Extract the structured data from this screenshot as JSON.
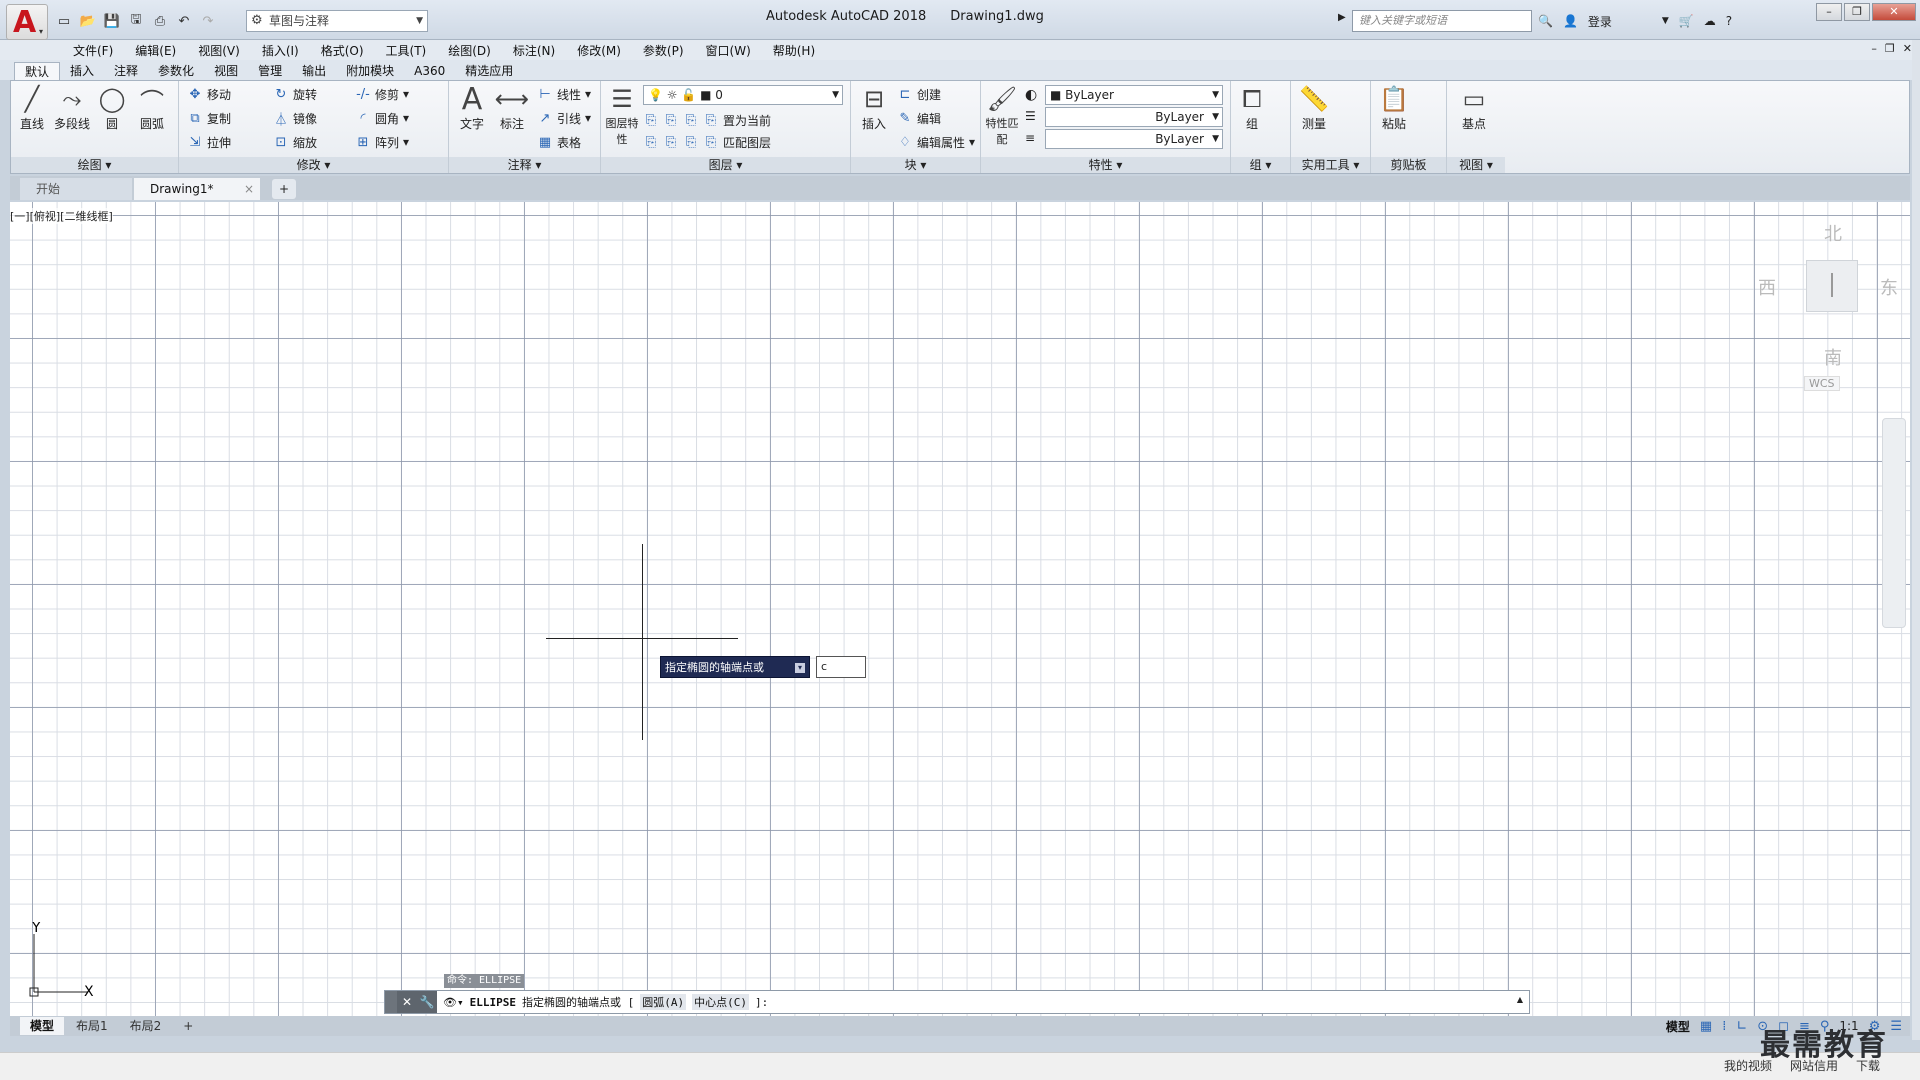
{
  "app": {
    "logo_letter": "A",
    "title": "Autodesk AutoCAD 2018",
    "document": "Drawing1.dwg",
    "workspace": "草图与注释",
    "search_placeholder": "键入关键字或短语",
    "login_label": "登录"
  },
  "menubar": [
    "文件(F)",
    "编辑(E)",
    "视图(V)",
    "插入(I)",
    "格式(O)",
    "工具(T)",
    "绘图(D)",
    "标注(N)",
    "修改(M)",
    "参数(P)",
    "窗口(W)",
    "帮助(H)"
  ],
  "ribbon_tabs": [
    "默认",
    "插入",
    "注释",
    "参数化",
    "视图",
    "管理",
    "输出",
    "附加模块",
    "A360",
    "精选应用"
  ],
  "panels": {
    "draw": {
      "title": "绘图",
      "line": "直线",
      "polyline": "多段线",
      "circle": "圆",
      "arc": "圆弧"
    },
    "modify": {
      "title": "修改",
      "move": "移动",
      "rotate": "旋转",
      "trim": "修剪",
      "copy": "复制",
      "mirror": "镜像",
      "fillet": "圆角",
      "stretch": "拉伸",
      "scale": "缩放",
      "array": "阵列"
    },
    "annotation": {
      "title": "注释",
      "text": "文字",
      "dimension": "标注",
      "linear": "线性",
      "leader": "引线",
      "table": "表格"
    },
    "layers": {
      "title": "图层",
      "props": "图层特性",
      "current_layer": "0",
      "set_current": "置为当前",
      "match": "匹配图层"
    },
    "block": {
      "title": "块",
      "insert": "插入",
      "create": "创建",
      "edit": "编辑",
      "edit_attr": "编辑属性"
    },
    "properties": {
      "title": "特性",
      "match": "特性匹配",
      "color": "ByLayer",
      "linetype": "ByLayer",
      "lineweight": "ByLayer"
    },
    "groups": {
      "title": "组",
      "group": "组"
    },
    "utilities": {
      "title": "实用工具",
      "measure": "测量"
    },
    "clipboard": {
      "title": "剪贴板",
      "paste": "粘贴"
    },
    "view": {
      "title": "视图",
      "base": "基点"
    }
  },
  "doc_tabs": {
    "start": "开始",
    "active": "Drawing1*"
  },
  "viewport": {
    "label": "[一][俯视][二维线框]",
    "cube": {
      "north": "北",
      "south": "南",
      "west": "西",
      "east": "东",
      "wcs": "WCS"
    }
  },
  "dynamic_input": {
    "tooltip": "指定椭圆的轴端点或",
    "value": "c"
  },
  "ucs": {
    "x": "X",
    "y": "Y"
  },
  "command": {
    "history": "命令: ELLIPSE",
    "prompt_cmd": "ELLIPSE",
    "prompt_text": "指定椭圆的轴端点或 [",
    "option_arc": "圆弧(A)",
    "option_center": "中心点(C)",
    "prompt_end": "]:"
  },
  "layout_tabs": [
    "模型",
    "布局1",
    "布局2"
  ],
  "status": {
    "model": "模型",
    "scale": "1:1"
  },
  "taskbar": [
    "我的视频",
    "网站信用",
    "下载"
  ],
  "watermark": "最需教育",
  "colors": {
    "accent": "#2a66b5",
    "tooltip_bg": "#1f2a53",
    "logo_red": "#c8161d"
  }
}
